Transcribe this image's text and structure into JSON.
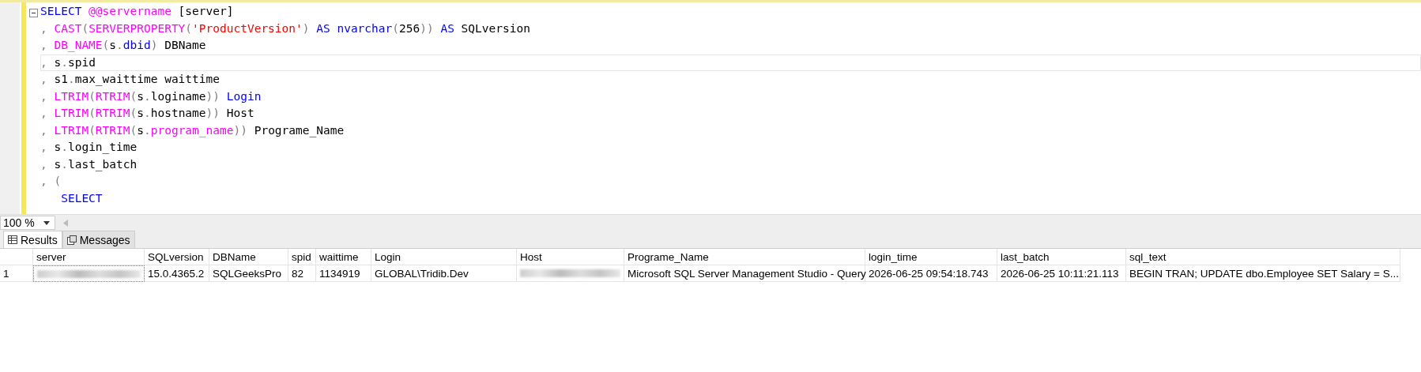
{
  "editor": {
    "lines": [
      {
        "current": false,
        "tokens": [
          {
            "kind": "kw",
            "text": "SELECT"
          },
          {
            "kind": "fn",
            "text": " @@servername"
          },
          {
            "kind": "id",
            "text": " [server]"
          }
        ]
      },
      {
        "current": false,
        "tokens": [
          {
            "kind": "op",
            "text": ", "
          },
          {
            "kind": "fn",
            "text": "CAST"
          },
          {
            "kind": "op",
            "text": "("
          },
          {
            "kind": "fn",
            "text": "SERVERPROPERTY"
          },
          {
            "kind": "op",
            "text": "("
          },
          {
            "kind": "str",
            "text": "'ProductVersion'"
          },
          {
            "kind": "op",
            "text": ")"
          },
          {
            "kind": "kw",
            "text": " AS nvarchar"
          },
          {
            "kind": "op",
            "text": "("
          },
          {
            "kind": "id",
            "text": "256"
          },
          {
            "kind": "op",
            "text": "))"
          },
          {
            "kind": "kw",
            "text": " AS"
          },
          {
            "kind": "id",
            "text": " SQLversion"
          }
        ]
      },
      {
        "current": false,
        "tokens": [
          {
            "kind": "op",
            "text": ", "
          },
          {
            "kind": "fn",
            "text": "DB_NAME"
          },
          {
            "kind": "op",
            "text": "("
          },
          {
            "kind": "id",
            "text": "s"
          },
          {
            "kind": "op",
            "text": "."
          },
          {
            "kind": "kw",
            "text": "dbid"
          },
          {
            "kind": "op",
            "text": ")"
          },
          {
            "kind": "id",
            "text": " DBName"
          }
        ]
      },
      {
        "current": true,
        "tokens": [
          {
            "kind": "op",
            "text": ", "
          },
          {
            "kind": "id",
            "text": "s"
          },
          {
            "kind": "op",
            "text": "."
          },
          {
            "kind": "id",
            "text": "spid"
          }
        ]
      },
      {
        "current": false,
        "tokens": [
          {
            "kind": "op",
            "text": ", "
          },
          {
            "kind": "id",
            "text": "s1"
          },
          {
            "kind": "op",
            "text": "."
          },
          {
            "kind": "id",
            "text": "max_waittime waittime"
          }
        ]
      },
      {
        "current": false,
        "tokens": [
          {
            "kind": "op",
            "text": ", "
          },
          {
            "kind": "fn",
            "text": "LTRIM"
          },
          {
            "kind": "op",
            "text": "("
          },
          {
            "kind": "fn",
            "text": "RTRIM"
          },
          {
            "kind": "op",
            "text": "("
          },
          {
            "kind": "id",
            "text": "s"
          },
          {
            "kind": "op",
            "text": "."
          },
          {
            "kind": "id",
            "text": "loginame"
          },
          {
            "kind": "op",
            "text": "))"
          },
          {
            "kind": "kw",
            "text": " Login"
          }
        ]
      },
      {
        "current": false,
        "tokens": [
          {
            "kind": "op",
            "text": ", "
          },
          {
            "kind": "fn",
            "text": "LTRIM"
          },
          {
            "kind": "op",
            "text": "("
          },
          {
            "kind": "fn",
            "text": "RTRIM"
          },
          {
            "kind": "op",
            "text": "("
          },
          {
            "kind": "id",
            "text": "s"
          },
          {
            "kind": "op",
            "text": "."
          },
          {
            "kind": "id",
            "text": "hostname"
          },
          {
            "kind": "op",
            "text": "))"
          },
          {
            "kind": "id",
            "text": " Host"
          }
        ]
      },
      {
        "current": false,
        "tokens": [
          {
            "kind": "op",
            "text": ", "
          },
          {
            "kind": "fn",
            "text": "LTRIM"
          },
          {
            "kind": "op",
            "text": "("
          },
          {
            "kind": "fn",
            "text": "RTRIM"
          },
          {
            "kind": "op",
            "text": "("
          },
          {
            "kind": "id",
            "text": "s"
          },
          {
            "kind": "op",
            "text": "."
          },
          {
            "kind": "fn",
            "text": "program_name"
          },
          {
            "kind": "op",
            "text": "))"
          },
          {
            "kind": "id",
            "text": " Programe_Name"
          }
        ]
      },
      {
        "current": false,
        "tokens": [
          {
            "kind": "op",
            "text": ", "
          },
          {
            "kind": "id",
            "text": "s"
          },
          {
            "kind": "op",
            "text": "."
          },
          {
            "kind": "id",
            "text": "login_time"
          }
        ]
      },
      {
        "current": false,
        "tokens": [
          {
            "kind": "op",
            "text": ", "
          },
          {
            "kind": "id",
            "text": "s"
          },
          {
            "kind": "op",
            "text": "."
          },
          {
            "kind": "id",
            "text": "last_batch"
          }
        ]
      },
      {
        "current": false,
        "tokens": [
          {
            "kind": "op",
            "text": ", ("
          }
        ]
      },
      {
        "current": false,
        "tokens": [
          {
            "kind": "kw",
            "text": "   SELECT"
          }
        ]
      }
    ]
  },
  "zoom": {
    "value": "100 %"
  },
  "tabs": [
    {
      "label": "Results",
      "selected": true,
      "kind": "grid"
    },
    {
      "label": "Messages",
      "selected": false,
      "kind": "messages"
    }
  ],
  "grid": {
    "columns": [
      "server",
      "SQLversion",
      "DBName",
      "spid",
      "waittime",
      "Login",
      "Host",
      "Programe_Name",
      "login_time",
      "last_batch",
      "sql_text"
    ],
    "rows": [
      {
        "number": "1",
        "cells": [
          {
            "kind": "blurred"
          },
          {
            "kind": "text",
            "text": "15.0.4365.2"
          },
          {
            "kind": "text",
            "text": "SQLGeeksPro"
          },
          {
            "kind": "text",
            "text": "82"
          },
          {
            "kind": "text",
            "text": "1134919"
          },
          {
            "kind": "text",
            "text": "GLOBAL\\Tridib.Dev"
          },
          {
            "kind": "blurred"
          },
          {
            "kind": "text",
            "text": "Microsoft SQL Server Management Studio - Query"
          },
          {
            "kind": "text",
            "text": "2026-06-25 09:54:18.743"
          },
          {
            "kind": "text",
            "text": "2026-06-25 10:11:21.113"
          },
          {
            "kind": "text",
            "text": "BEGIN TRAN;   UPDATE dbo.Employee SET Salary = S..."
          }
        ]
      }
    ]
  }
}
